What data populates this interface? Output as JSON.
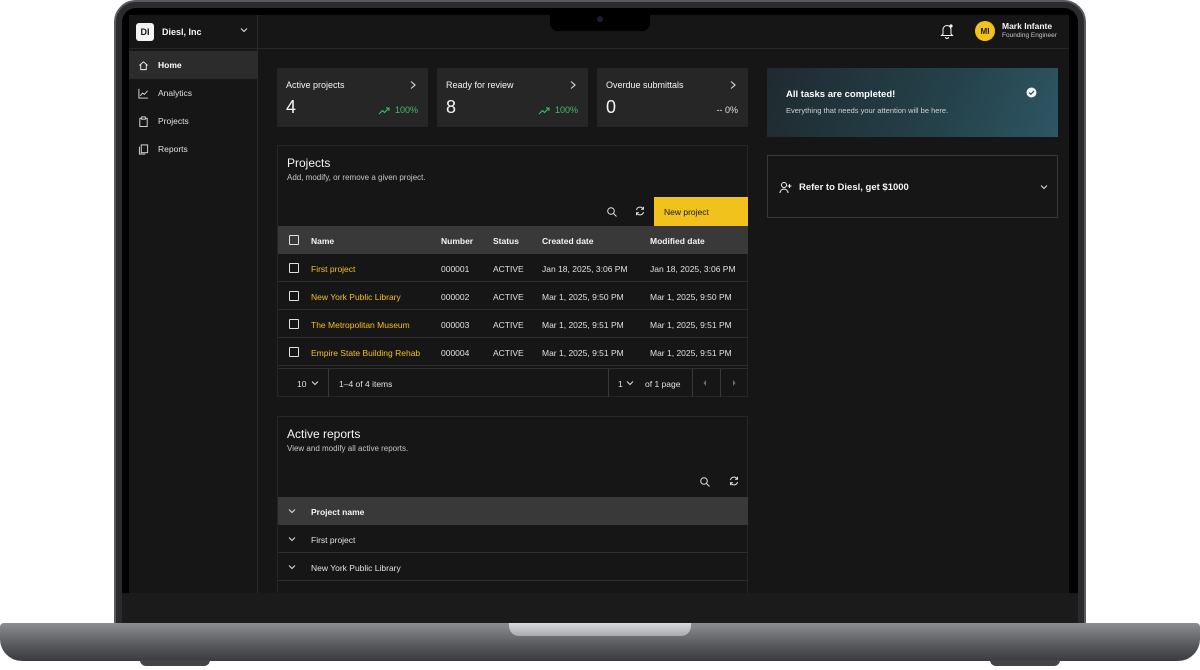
{
  "org": {
    "badge": "DI",
    "name": "Diesl, Inc"
  },
  "sidebar": {
    "items": [
      {
        "label": "Home",
        "icon": "home-icon",
        "active": true
      },
      {
        "label": "Analytics",
        "icon": "analytics-icon",
        "active": false
      },
      {
        "label": "Projects",
        "icon": "projects-icon",
        "active": false
      },
      {
        "label": "Reports",
        "icon": "reports-icon",
        "active": false
      }
    ]
  },
  "header": {
    "avatar_initials": "MI",
    "user_name": "Mark Infante",
    "user_role": "Founding Engineer"
  },
  "tiles": [
    {
      "title": "Active projects",
      "value": "4",
      "change": "100%",
      "trend": "up"
    },
    {
      "title": "Ready for review",
      "value": "8",
      "change": "100%",
      "trend": "up"
    },
    {
      "title": "Overdue submittals",
      "value": "0",
      "change": "-- 0%",
      "trend": "neutral"
    }
  ],
  "projects": {
    "title": "Projects",
    "subtitle": "Add, modify, or remove a given project.",
    "new_button": "New project",
    "columns": [
      "Name",
      "Number",
      "Status",
      "Created date",
      "Modified date"
    ],
    "rows": [
      [
        "First project",
        "000001",
        "ACTIVE",
        "Jan 18, 2025, 3:06 PM",
        "Jan 18, 2025, 3:06 PM"
      ],
      [
        "New York Public Library",
        "000002",
        "ACTIVE",
        "Mar 1, 2025, 9:50 PM",
        "Mar 1, 2025, 9:50 PM"
      ],
      [
        "The Metropolitan Museum",
        "000003",
        "ACTIVE",
        "Mar 1, 2025, 9:51 PM",
        "Mar 1, 2025, 9:51 PM"
      ],
      [
        "Empire State Building Rehab",
        "000004",
        "ACTIVE",
        "Mar 1, 2025, 9:51 PM",
        "Mar 1, 2025, 9:51 PM"
      ]
    ],
    "pager": {
      "page_size": "10",
      "range": "1–4 of 4 items",
      "page": "1",
      "of_pages": "of 1 page"
    }
  },
  "notice": {
    "title": "All tasks are completed!",
    "subtitle": "Everything that needs your attention will be here."
  },
  "refer": {
    "label": "Refer to Diesl, get $1000"
  },
  "reports": {
    "title": "Active reports",
    "subtitle": "View and modify all active reports.",
    "column": "Project name",
    "rows": [
      "First project",
      "New York Public Library"
    ]
  },
  "colors": {
    "accent": "#f1c21b",
    "positive": "#42be65",
    "background": "#161616",
    "surface": "#262626"
  }
}
